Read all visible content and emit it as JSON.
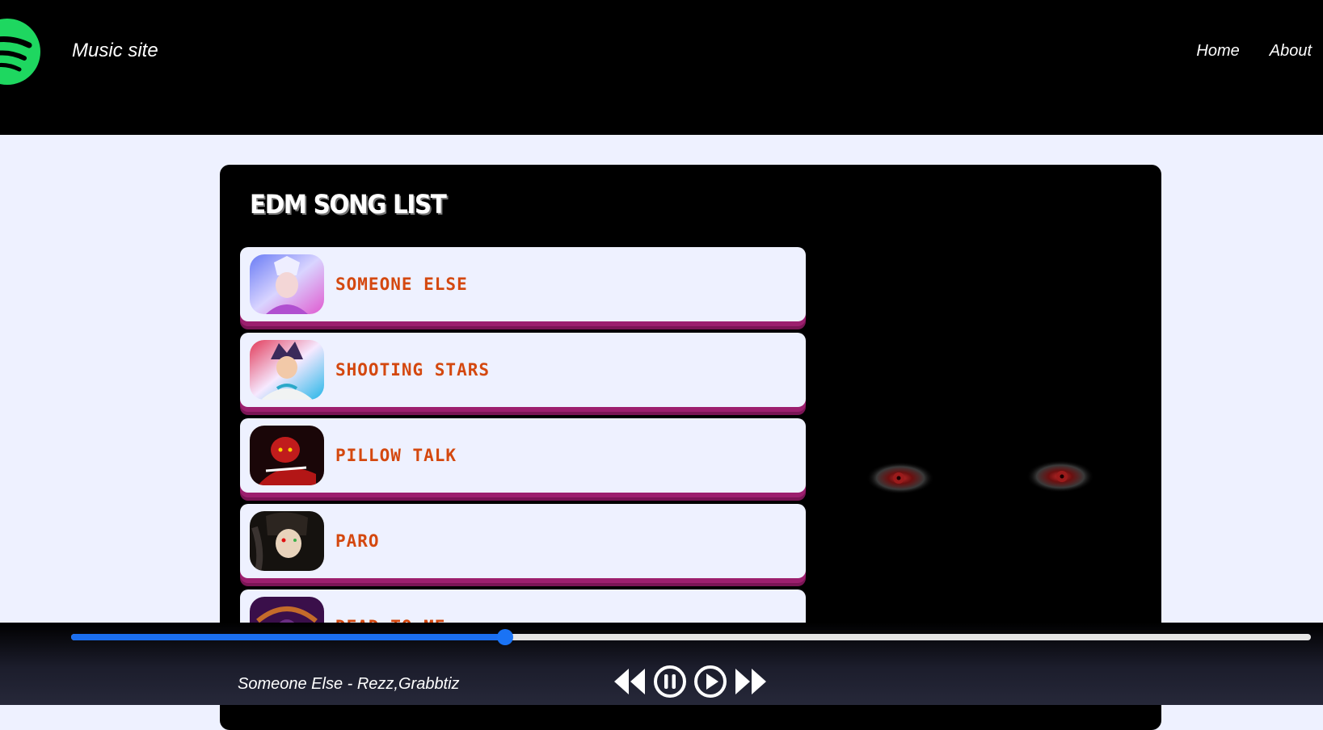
{
  "navbar": {
    "site_title": "Music site",
    "links": [
      "Home",
      "About"
    ],
    "logo_icon": "spotify-logo-icon"
  },
  "main": {
    "heading": "EDM SONG LIST",
    "songs": [
      {
        "title": "Someone Else",
        "cover": "anime-cover-1"
      },
      {
        "title": "Shooting Stars",
        "cover": "anime-cover-2"
      },
      {
        "title": "Pillow Talk",
        "cover": "anime-cover-3"
      },
      {
        "title": "Paro",
        "cover": "anime-cover-4"
      },
      {
        "title": "Dead to Me",
        "cover": "anime-cover-5"
      }
    ]
  },
  "player": {
    "now_playing": "Someone Else - Rezz,Grabbtiz",
    "progress_fraction": 0.35,
    "controls": [
      "rewind-icon",
      "pause-icon",
      "play-icon",
      "fast-forward-icon"
    ]
  },
  "colors": {
    "navbar_bg": "#000000",
    "page_bg": "#eef1ff",
    "song_title": "#d4480f",
    "song_card_border": "#9c1f6e",
    "progress_fill": "#1b6ff0",
    "logo_green": "#1ed760"
  }
}
